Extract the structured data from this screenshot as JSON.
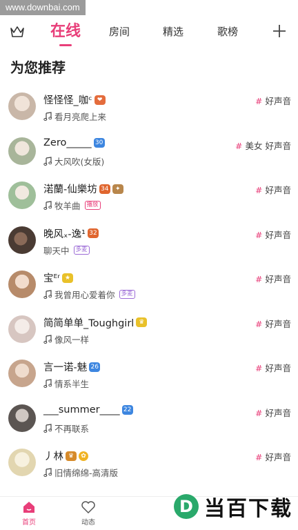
{
  "watermark_top": "www.downbai.com",
  "tabs": [
    {
      "label": "在线",
      "active": true
    },
    {
      "label": "房间",
      "active": false
    },
    {
      "label": "精选",
      "active": false
    },
    {
      "label": "歌榜",
      "active": false
    }
  ],
  "section_title": "为您推荐",
  "users": [
    {
      "name": "怪怪怪_咖ᶜ",
      "sub": "看月亮爬上来",
      "sub_icon": "music-note",
      "pill": "",
      "tags": [
        "好声音"
      ],
      "avatar_color": "#c9b7a8"
    },
    {
      "name": "Zero_____",
      "sub": "大风吹(女版)",
      "sub_icon": "music-note",
      "pill": "",
      "tags": [
        "美女",
        "好声音"
      ],
      "avatar_color": "#a8b59a"
    },
    {
      "name": "渃蘭-仙樂坊",
      "sub": "牧羊曲",
      "sub_icon": "music-note",
      "pill": "播放",
      "tags": [
        "好声音"
      ],
      "avatar_color": "#9fbf9a"
    },
    {
      "name": "晚风ₓ-逸¹",
      "sub": "聊天中",
      "sub_icon": "",
      "pill": "多麦",
      "tags": [
        "好声音"
      ],
      "avatar_color": "#4a3b33"
    },
    {
      "name": "宝ᴱʳ",
      "sub": "我曾用心爱着你",
      "sub_icon": "music-note",
      "pill": "多麦",
      "tags": [
        "好声音"
      ],
      "avatar_color": "#b78b6a"
    },
    {
      "name": "简简单单_Toughgirl",
      "sub": "像风一样",
      "sub_icon": "music-note",
      "pill": "",
      "tags": [
        "好声音"
      ],
      "avatar_color": "#d7c6c1"
    },
    {
      "name": "言一诺-魅",
      "sub": "情系半生",
      "sub_icon": "music-note",
      "pill": "",
      "tags": [
        "好声音"
      ],
      "avatar_color": "#c7a58d"
    },
    {
      "name": "___summer____",
      "sub": "不再联系",
      "sub_icon": "music-note",
      "pill": "",
      "tags": [
        "好声音"
      ],
      "avatar_color": "#5b5552"
    },
    {
      "name": "丿林",
      "sub": "旧情绵绵-高清版",
      "sub_icon": "music-note",
      "pill": "",
      "tags": [
        "好声音"
      ],
      "avatar_color": "#e2d6b0"
    }
  ],
  "bottom_nav": [
    {
      "label": "首页",
      "active": true
    },
    {
      "label": "动态",
      "active": false
    }
  ],
  "watermark_logo": "当百下载",
  "colors": {
    "accent": "#e83e79"
  }
}
